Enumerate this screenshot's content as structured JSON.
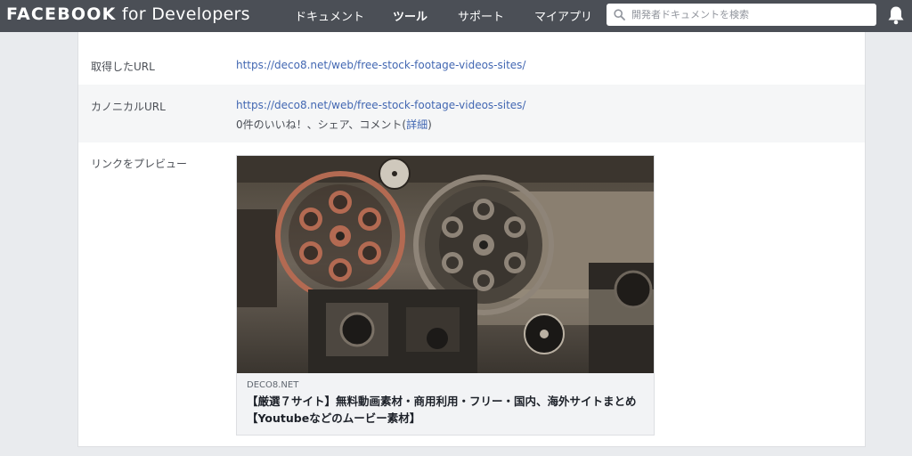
{
  "brand": {
    "bold": "FACEBOOK",
    "rest": " for Developers"
  },
  "nav": {
    "items": [
      {
        "label": "ドキュメント"
      },
      {
        "label": "ツール"
      },
      {
        "label": "サポート"
      },
      {
        "label": "マイアプリ"
      }
    ],
    "active_index": 1
  },
  "search": {
    "placeholder": "開発者ドキュメントを検索",
    "value": ""
  },
  "rows": {
    "fetched_url": {
      "label": "取得したURL",
      "value": "https://deco8.net/web/free-stock-footage-videos-sites/"
    },
    "canonical_url": {
      "label": "カノニカルURL",
      "value": "https://deco8.net/web/free-stock-footage-videos-sites/",
      "engagement_text": "0件のいいね！、シェア、コメント(",
      "details_link": "詳細",
      "engagement_close": ")"
    },
    "link_preview": {
      "label": "リンクをプレビュー"
    }
  },
  "preview": {
    "domain": "DECO8.NET",
    "title": "【厳選７サイト】無料動画素材・商用利用・フリー・国内、海外サイトまとめ【Youtubeなどのムービー素材】"
  },
  "colors": {
    "topbar": "#4b4f56",
    "link": "#4267b2",
    "page_bg": "#e9ebee",
    "alt_row": "#f5f6f7"
  }
}
